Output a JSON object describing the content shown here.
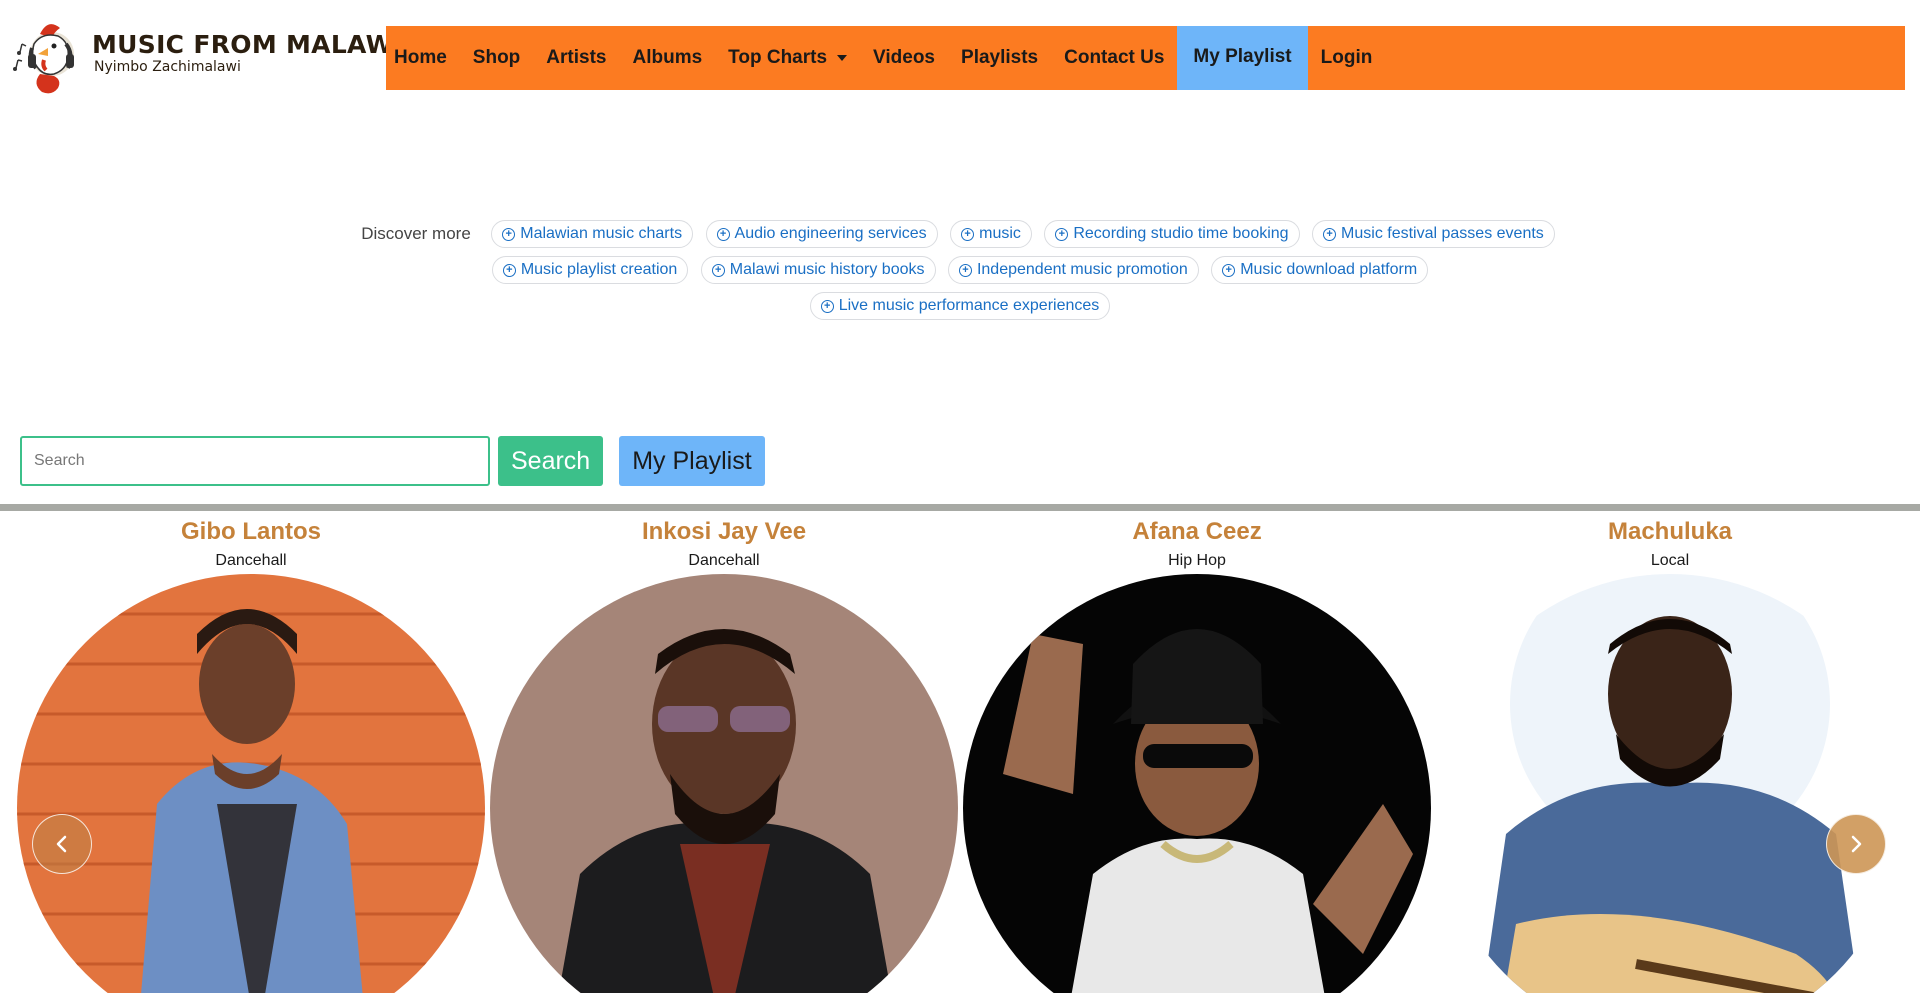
{
  "header": {
    "logo_title": "MUSIC FROM MALAWI",
    "logo_subtitle": "Nyimbo Zachimalawi"
  },
  "nav": {
    "items": [
      {
        "label": "Home"
      },
      {
        "label": "Shop"
      },
      {
        "label": "Artists"
      },
      {
        "label": "Albums"
      },
      {
        "label": "Top Charts"
      },
      {
        "label": "Videos"
      },
      {
        "label": "Playlists"
      },
      {
        "label": "Contact Us"
      },
      {
        "label": "My Playlist"
      },
      {
        "label": "Login"
      }
    ],
    "active_color": "#6eb5f9",
    "bar_color": "#fc7b21"
  },
  "discover": {
    "label": "Discover more",
    "chips": [
      "Malawian music charts",
      "Audio engineering services",
      "music",
      "Recording studio time booking",
      "Music festival passes events",
      "Music playlist creation",
      "Malawi music history books",
      "Independent music promotion",
      "Music download platform",
      "Live music performance experiences"
    ]
  },
  "search": {
    "placeholder": "Search",
    "value": "",
    "search_button": "Search",
    "playlist_button": "My Playlist"
  },
  "artists": [
    {
      "name": "Gibo Lantos",
      "genre": "Dancehall"
    },
    {
      "name": "Inkosi Jay Vee",
      "genre": "Dancehall"
    },
    {
      "name": "Afana Ceez",
      "genre": "Hip Hop"
    },
    {
      "name": "Machuluka",
      "genre": "Local"
    }
  ],
  "carousel": {
    "prev_icon": "chevron-left-icon",
    "next_icon": "chevron-right-icon"
  }
}
